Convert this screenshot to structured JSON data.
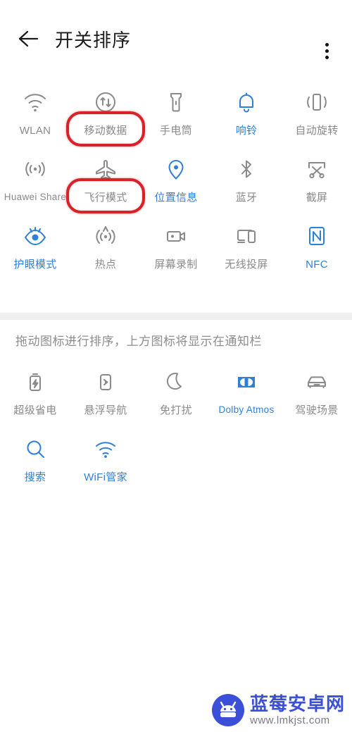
{
  "appbar": {
    "title": "开关排序",
    "back_icon": "arrow-left-icon",
    "more_icon": "more-vertical-icon"
  },
  "notification_grid": {
    "items": [
      {
        "label": "WLAN",
        "icon": "wifi-icon",
        "active": false,
        "highlighted": false
      },
      {
        "label": "移动数据",
        "icon": "mobile-data-icon",
        "active": false,
        "highlighted": true
      },
      {
        "label": "手电筒",
        "icon": "flashlight-icon",
        "active": false,
        "highlighted": false
      },
      {
        "label": "响铃",
        "icon": "bell-icon",
        "active": true,
        "highlighted": false
      },
      {
        "label": "自动旋转",
        "icon": "auto-rotate-icon",
        "active": false,
        "highlighted": false
      },
      {
        "label": "Huawei Share",
        "icon": "huawei-share-icon",
        "active": false,
        "highlighted": false
      },
      {
        "label": "飞行模式",
        "icon": "airplane-icon",
        "active": false,
        "highlighted": true
      },
      {
        "label": "位置信息",
        "icon": "location-pin-icon",
        "active": true,
        "highlighted": false
      },
      {
        "label": "蓝牙",
        "icon": "bluetooth-icon",
        "active": false,
        "highlighted": false
      },
      {
        "label": "截屏",
        "icon": "screenshot-icon",
        "active": false,
        "highlighted": false
      },
      {
        "label": "护眼模式",
        "icon": "eye-comfort-icon",
        "active": true,
        "highlighted": false
      },
      {
        "label": "热点",
        "icon": "hotspot-icon",
        "active": false,
        "highlighted": false
      },
      {
        "label": "屏幕录制",
        "icon": "screen-record-icon",
        "active": false,
        "highlighted": false
      },
      {
        "label": "无线投屏",
        "icon": "cast-icon",
        "active": false,
        "highlighted": false
      },
      {
        "label": "NFC",
        "icon": "nfc-icon",
        "active": true,
        "highlighted": false
      }
    ]
  },
  "hint": "拖动图标进行排序，上方图标将显示在通知栏",
  "hidden_grid": {
    "items": [
      {
        "label": "超级省电",
        "icon": "battery-saver-icon",
        "active": false
      },
      {
        "label": "悬浮导航",
        "icon": "floating-nav-icon",
        "active": false
      },
      {
        "label": "免打扰",
        "icon": "moon-icon",
        "active": false
      },
      {
        "label": "Dolby Atmos",
        "icon": "dolby-icon",
        "active": true
      },
      {
        "label": "驾驶场景",
        "icon": "car-icon",
        "active": false
      },
      {
        "label": "搜索",
        "icon": "search-icon",
        "active": true
      },
      {
        "label": "WiFi管家",
        "icon": "wifi-manager-icon",
        "active": true
      }
    ]
  },
  "watermark": {
    "title": "蓝莓安卓网",
    "url": "www.lmkjst.com",
    "logo_icon": "android-robot-icon"
  },
  "colors": {
    "accent_blue": "#2f7fd6",
    "inactive_gray": "#8a8a8a",
    "highlight_red": "#d8222a",
    "divider": "#f0f0f1"
  }
}
